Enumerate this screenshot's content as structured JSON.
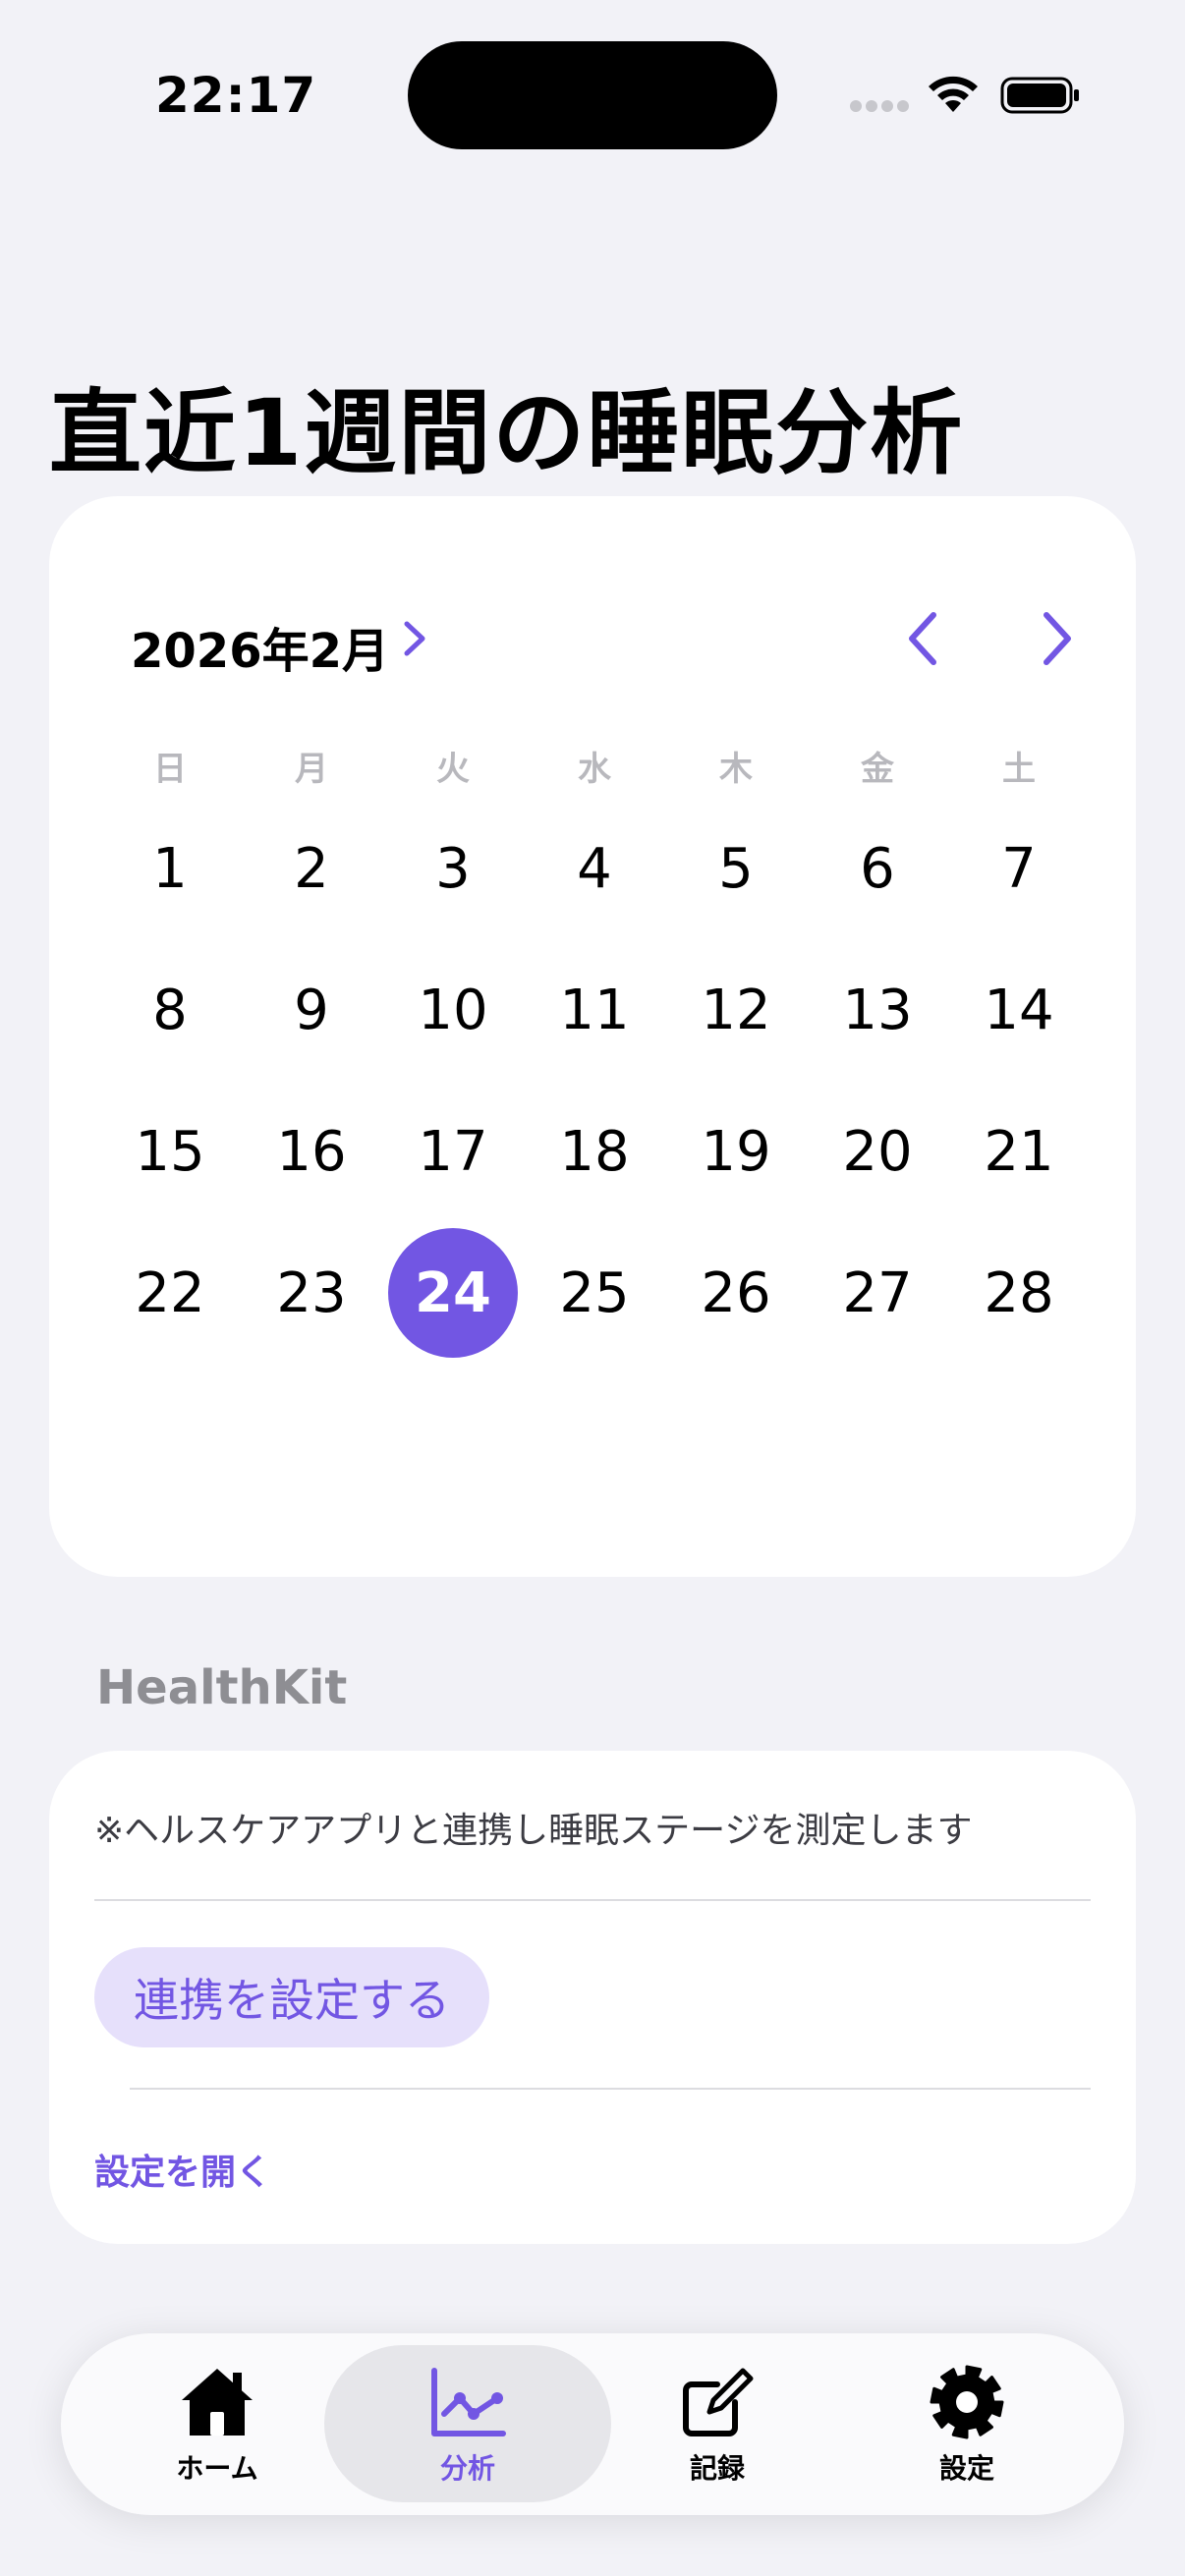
{
  "status_bar": {
    "time": "22:17"
  },
  "page": {
    "title": "直近1週間の睡眠分析"
  },
  "calendar": {
    "month_label": "2026年2月",
    "weekdays": [
      "日",
      "月",
      "火",
      "水",
      "木",
      "金",
      "土"
    ],
    "weeks": [
      [
        "1",
        "2",
        "3",
        "4",
        "5",
        "6",
        "7"
      ],
      [
        "8",
        "9",
        "10",
        "11",
        "12",
        "13",
        "14"
      ],
      [
        "15",
        "16",
        "17",
        "18",
        "19",
        "20",
        "21"
      ],
      [
        "22",
        "23",
        "24",
        "25",
        "26",
        "27",
        "28"
      ]
    ],
    "selected_day": "24",
    "accent_color": "#7256e3"
  },
  "healthkit": {
    "section_title": "HealthKit",
    "note": "※ヘルスケアアプリと連携し睡眠ステージを測定します",
    "link_button_label": "連携を設定する",
    "open_settings_label": "設定を開く"
  },
  "tab_bar": {
    "items": [
      {
        "label": "ホーム",
        "icon": "house-icon"
      },
      {
        "label": "分析",
        "icon": "chart-line-icon"
      },
      {
        "label": "記録",
        "icon": "square-pencil-icon"
      },
      {
        "label": "設定",
        "icon": "gear-icon"
      }
    ],
    "active_index": 1
  }
}
